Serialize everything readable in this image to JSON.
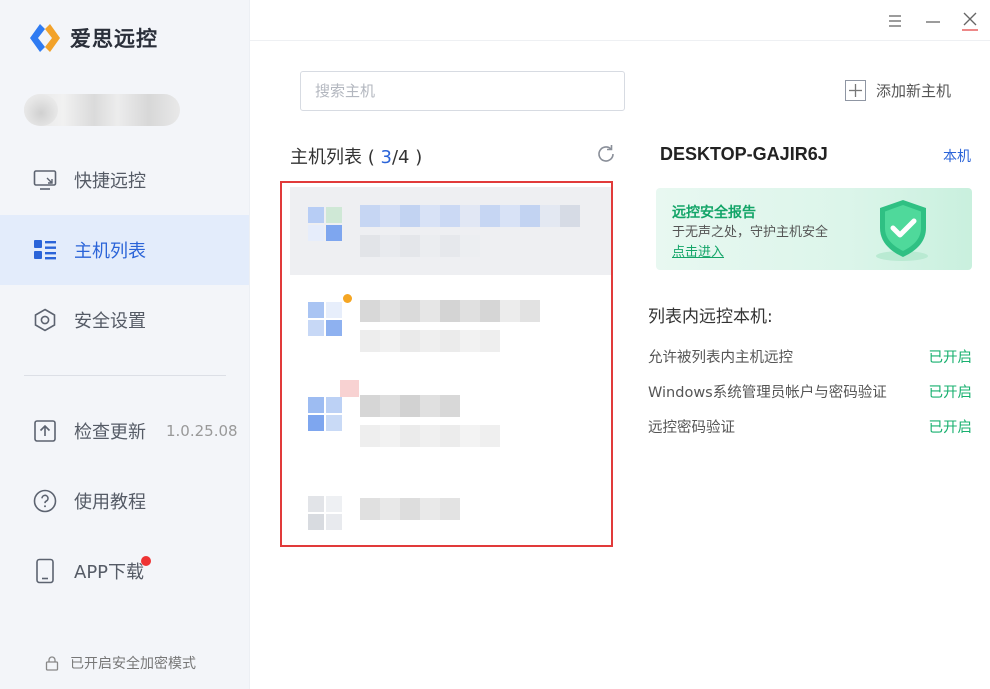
{
  "app": {
    "name": "爱思远控"
  },
  "sidebar": {
    "items": [
      {
        "label": "快捷远控",
        "icon": "monitor-icon"
      },
      {
        "label": "主机列表",
        "icon": "host-list-icon"
      },
      {
        "label": "安全设置",
        "icon": "shield-hex-icon"
      },
      {
        "label": "检查更新",
        "icon": "upload-icon",
        "version": "1.0.25.08"
      },
      {
        "label": "使用教程",
        "icon": "help-icon"
      },
      {
        "label": "APP下载",
        "icon": "phone-icon"
      }
    ],
    "active_index": 1,
    "encrypt_note": "已开启安全加密模式"
  },
  "window_controls": [
    "menu-icon",
    "minimize-icon",
    "close-icon"
  ],
  "search": {
    "placeholder": "搜索主机"
  },
  "add_host": {
    "label": "添加新主机"
  },
  "host_list": {
    "title": "主机列表",
    "open_paren": "(",
    "online_count": "3",
    "separator": "/",
    "total_count": "4",
    "close_paren": ")"
  },
  "detail": {
    "machine_name": "DESKTOP-GAJIR6J",
    "this_machine_label": "本机",
    "security_report": {
      "title": "远控安全报告",
      "subtitle": "于无声之处，守护主机安全",
      "link": "点击进入"
    },
    "settings_title": "列表内远控本机:",
    "settings": [
      {
        "name": "允许被列表内主机远控",
        "value": "已开启"
      },
      {
        "name": "Windows系统管理员帐户与密码验证",
        "value": "已开启"
      },
      {
        "name": "远控密码验证",
        "value": "已开启"
      }
    ]
  },
  "colors": {
    "accent": "#2b64d8",
    "success": "#18b06f",
    "highlight_border": "#e13a3a",
    "sidebar_bg": "#f3f5f9",
    "active_item_bg": "#e3ecfb"
  }
}
